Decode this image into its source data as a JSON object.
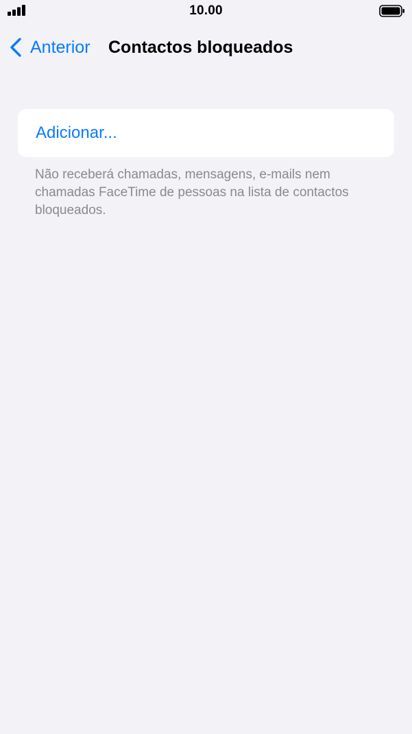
{
  "status_bar": {
    "time": "10.00",
    "signal_icon": "cellular-signal-icon",
    "battery_icon": "battery-icon"
  },
  "nav": {
    "back_label": "Anterior",
    "back_icon": "chevron-left-icon",
    "title": "Contactos bloqueados"
  },
  "blocked_list": {
    "add_label": "Adicionar...",
    "footnote": "Não receberá chamadas, mensagens, e-mails nem chamadas FaceTime de pessoas na lista de contactos bloqueados."
  },
  "colors": {
    "background": "#f2f2f7",
    "accent": "#0a7aff",
    "card": "#ffffff",
    "secondary_text": "#8a8a8e"
  }
}
